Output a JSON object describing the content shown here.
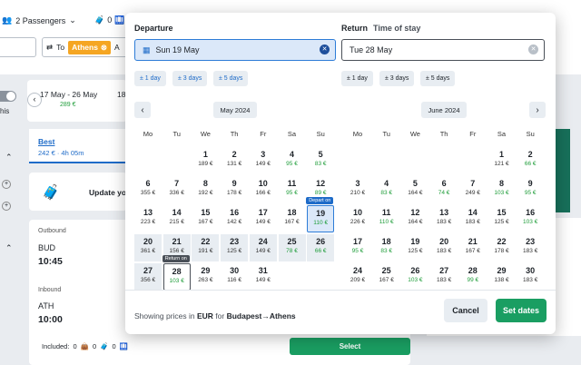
{
  "topbar": {
    "passengers": "2 Passengers",
    "bags_count": "0",
    "from_icon": "swap",
    "to_label": "To",
    "destination": "Athens",
    "destination_suffix": "A"
  },
  "background": {
    "date_range_label": "17 May - 26 May",
    "date_range_price": "289 €",
    "next_range_partial": "18",
    "best_tab_label": "Best",
    "best_tab_sub": "242 € · 4h 05m",
    "update_text": "Update yo",
    "toggle_label": "his",
    "outbound_label": "Outbound",
    "outbound_code": "BUD",
    "outbound_time": "10:45",
    "inbound_label": "Inbound",
    "inbound_code": "ATH",
    "inbound_time": "10:00",
    "included_label": "Included:",
    "inc1": "0",
    "inc2": "0",
    "inc3": "0",
    "select_label": "Select"
  },
  "picker": {
    "departure_title": "Departure",
    "departure_value": "Sun 19 May",
    "return_title": "Return",
    "time_of_stay": "Time of stay",
    "return_value": "Tue 28 May",
    "chips_left": [
      "± 1 day",
      "± 3 days",
      "± 5 days"
    ],
    "chips_right": [
      "± 1 day",
      "± 3 days",
      "± 5 days"
    ],
    "month_left": "May 2024",
    "month_right": "June 2024",
    "weekdays": [
      "Mo",
      "Tu",
      "We",
      "Th",
      "Fr",
      "Sa",
      "Su"
    ],
    "depart_tag": "Depart on",
    "return_tag": "Return on",
    "footer_prefix": "Showing prices in ",
    "currency": "EUR",
    "footer_mid": " for ",
    "route": "Budapest→Athens",
    "cancel_label": "Cancel",
    "set_label": "Set dates"
  },
  "may_days": [
    {
      "d": "1",
      "p": "189 €",
      "g": false
    },
    {
      "d": "2",
      "p": "131 €",
      "g": false
    },
    {
      "d": "3",
      "p": "149 €",
      "g": false
    },
    {
      "d": "4",
      "p": "95 €",
      "g": true
    },
    {
      "d": "5",
      "p": "83 €",
      "g": true
    },
    {
      "d": "6",
      "p": "355 €",
      "g": false
    },
    {
      "d": "7",
      "p": "336 €",
      "g": false
    },
    {
      "d": "8",
      "p": "192 €",
      "g": false
    },
    {
      "d": "9",
      "p": "178 €",
      "g": false
    },
    {
      "d": "10",
      "p": "166 €",
      "g": false
    },
    {
      "d": "11",
      "p": "95 €",
      "g": true
    },
    {
      "d": "12",
      "p": "89 €",
      "g": true
    },
    {
      "d": "13",
      "p": "223 €",
      "g": false
    },
    {
      "d": "14",
      "p": "215 €",
      "g": false
    },
    {
      "d": "15",
      "p": "167 €",
      "g": false
    },
    {
      "d": "16",
      "p": "142 €",
      "g": false
    },
    {
      "d": "17",
      "p": "149 €",
      "g": false
    },
    {
      "d": "18",
      "p": "167 €",
      "g": false
    },
    {
      "d": "19",
      "p": "110 €",
      "g": true
    },
    {
      "d": "20",
      "p": "361 €",
      "g": false
    },
    {
      "d": "21",
      "p": "156 €",
      "g": false
    },
    {
      "d": "22",
      "p": "191 €",
      "g": false
    },
    {
      "d": "23",
      "p": "125 €",
      "g": false
    },
    {
      "d": "24",
      "p": "149 €",
      "g": false
    },
    {
      "d": "25",
      "p": "78 €",
      "g": true
    },
    {
      "d": "26",
      "p": "66 €",
      "g": true
    },
    {
      "d": "27",
      "p": "356 €",
      "g": false
    },
    {
      "d": "28",
      "p": "103 €",
      "g": true
    },
    {
      "d": "29",
      "p": "263 €",
      "g": false
    },
    {
      "d": "30",
      "p": "116 €",
      "g": false
    },
    {
      "d": "31",
      "p": "149 €",
      "g": false
    }
  ],
  "june_days": [
    {
      "d": "1",
      "p": "121 €",
      "g": false
    },
    {
      "d": "2",
      "p": "66 €",
      "g": true
    },
    {
      "d": "3",
      "p": "210 €",
      "g": false
    },
    {
      "d": "4",
      "p": "83 €",
      "g": true
    },
    {
      "d": "5",
      "p": "164 €",
      "g": false
    },
    {
      "d": "6",
      "p": "74 €",
      "g": true
    },
    {
      "d": "7",
      "p": "249 €",
      "g": false
    },
    {
      "d": "8",
      "p": "103 €",
      "g": true
    },
    {
      "d": "9",
      "p": "95 €",
      "g": true
    },
    {
      "d": "10",
      "p": "226 €",
      "g": false
    },
    {
      "d": "11",
      "p": "110 €",
      "g": true
    },
    {
      "d": "12",
      "p": "164 €",
      "g": false
    },
    {
      "d": "13",
      "p": "183 €",
      "g": false
    },
    {
      "d": "14",
      "p": "183 €",
      "g": false
    },
    {
      "d": "15",
      "p": "125 €",
      "g": false
    },
    {
      "d": "16",
      "p": "103 €",
      "g": true
    },
    {
      "d": "17",
      "p": "95 €",
      "g": true
    },
    {
      "d": "18",
      "p": "83 €",
      "g": true
    },
    {
      "d": "19",
      "p": "125 €",
      "g": false
    },
    {
      "d": "20",
      "p": "183 €",
      "g": false
    },
    {
      "d": "21",
      "p": "167 €",
      "g": false
    },
    {
      "d": "22",
      "p": "178 €",
      "g": false
    },
    {
      "d": "23",
      "p": "183 €",
      "g": false
    },
    {
      "d": "24",
      "p": "209 €",
      "g": false
    },
    {
      "d": "25",
      "p": "167 €",
      "g": false
    },
    {
      "d": "26",
      "p": "103 €",
      "g": true
    },
    {
      "d": "27",
      "p": "183 €",
      "g": false
    },
    {
      "d": "28",
      "p": "99 €",
      "g": true
    },
    {
      "d": "29",
      "p": "138 €",
      "g": false
    },
    {
      "d": "30",
      "p": "183 €",
      "g": false
    }
  ],
  "colors": {
    "green": "#1f9d3a",
    "accent": "#1e6bc8",
    "button_green": "#1a9e62",
    "tag_dark": "#4a5058",
    "destination_chip": "#f5a623"
  }
}
